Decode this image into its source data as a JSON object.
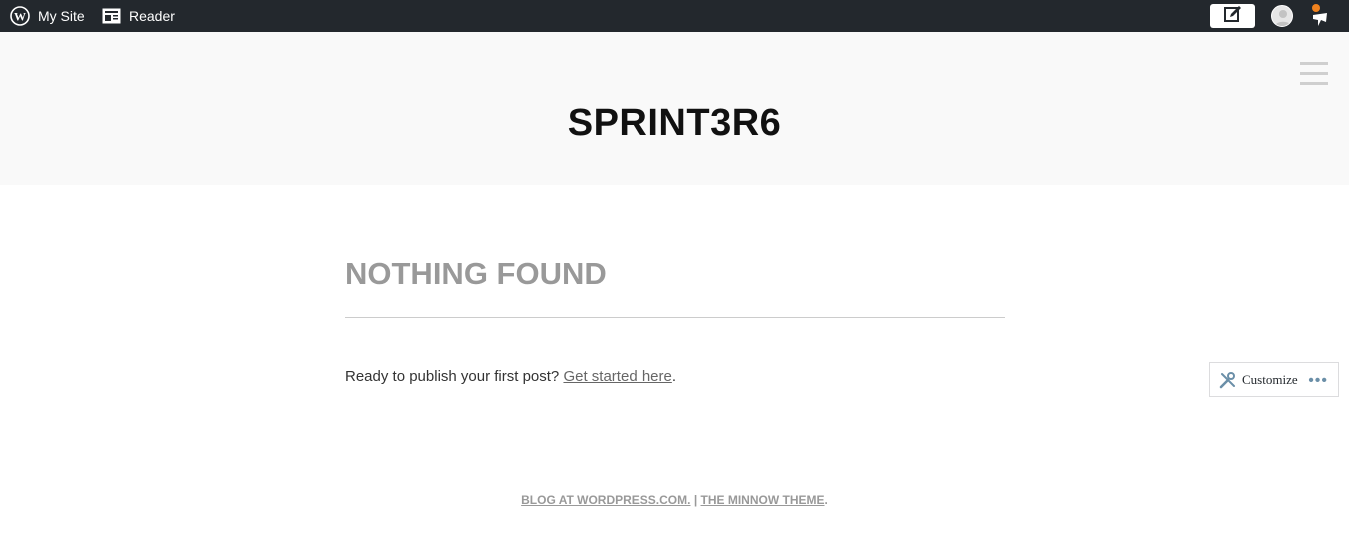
{
  "admin_bar": {
    "my_site_label": "My Site",
    "reader_label": "Reader"
  },
  "header": {
    "site_title": "SPRINT3R6"
  },
  "main": {
    "title": "NOTHING FOUND",
    "message": "Ready to publish your first post?",
    "link": "Get started here",
    "after_link": "."
  },
  "customize": {
    "label": "Customize",
    "more": "•••"
  },
  "footer": {
    "blog_link": "BLOG AT WORDPRESS.COM.",
    "separator": " | ",
    "theme_link": "THE MINNOW THEME",
    "end": "."
  },
  "colors": {
    "admin_bar": "#23282d",
    "header_bg": "#f9f9f9",
    "notification_dot": "#f0821e"
  }
}
